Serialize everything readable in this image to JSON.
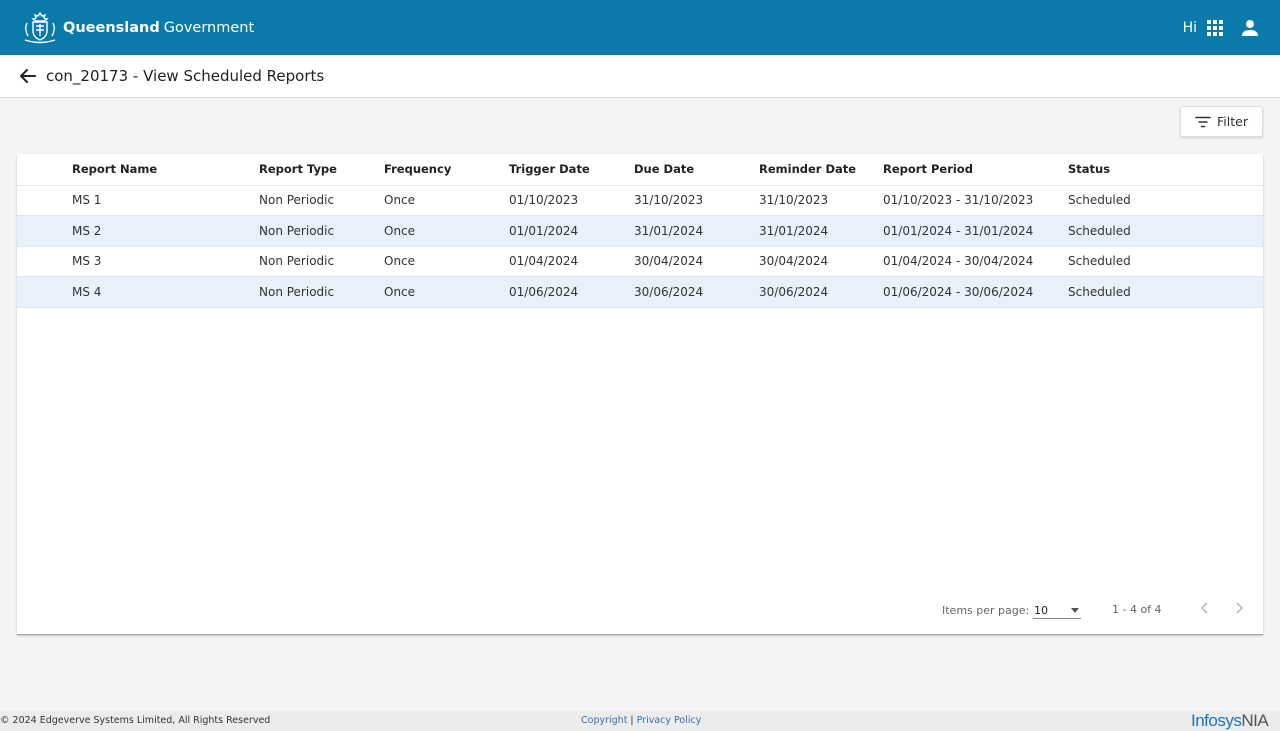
{
  "header": {
    "brand_bold": "Queensland",
    "brand_light": "Government",
    "greeting": "Hi"
  },
  "titlebar": {
    "title": "con_20173 - View Scheduled Reports"
  },
  "toolbar": {
    "filter_label": "Filter"
  },
  "table": {
    "columns": [
      "Report Name",
      "Report Type",
      "Frequency",
      "Trigger Date",
      "Due Date",
      "Reminder Date",
      "Report Period",
      "Status"
    ],
    "rows": [
      [
        "MS 1",
        "Non Periodic",
        "Once",
        "01/10/2023",
        "31/10/2023",
        "31/10/2023",
        "01/10/2023 - 31/10/2023",
        "Scheduled"
      ],
      [
        "MS 2",
        "Non Periodic",
        "Once",
        "01/01/2024",
        "31/01/2024",
        "31/01/2024",
        "01/01/2024 - 31/01/2024",
        "Scheduled"
      ],
      [
        "MS 3",
        "Non Periodic",
        "Once",
        "01/04/2024",
        "30/04/2024",
        "30/04/2024",
        "01/04/2024 - 30/04/2024",
        "Scheduled"
      ],
      [
        "MS 4",
        "Non Periodic",
        "Once",
        "01/06/2024",
        "30/06/2024",
        "30/06/2024",
        "01/06/2024 - 30/06/2024",
        "Scheduled"
      ]
    ]
  },
  "paginator": {
    "items_per_page_label": "Items per page:",
    "items_per_page_value": "10",
    "range_label": "1 - 4 of 4"
  },
  "footer": {
    "copyright": "© 2024 Edgeverve Systems Limited, All Rights Reserved",
    "link_copyright": "Copyright",
    "separator": "|",
    "link_privacy": "Privacy Policy",
    "logo_infosys": "Infosys",
    "logo_nia": "NIA"
  },
  "colors": {
    "header_bg": "#0a7aaa",
    "row_alt_bg": "#e8f0fc",
    "link": "#3a6fb0"
  }
}
